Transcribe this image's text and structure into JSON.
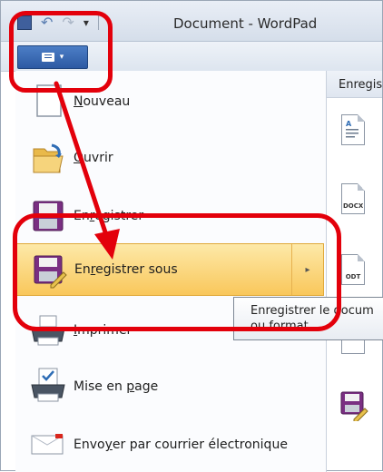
{
  "window": {
    "title": "Document - WordPad"
  },
  "app_button": {
    "icon": "document-icon",
    "caret": "▾"
  },
  "menu": {
    "items": [
      {
        "pre": "",
        "ul": "N",
        "post": "ouveau",
        "icon": "blank-page-icon"
      },
      {
        "pre": "",
        "ul": "O",
        "post": "uvrir",
        "icon": "open-folder-icon"
      },
      {
        "pre": "En",
        "ul": "r",
        "post": "egistrer",
        "icon": "floppy-disk-icon"
      },
      {
        "pre": "En",
        "ul": "r",
        "post": "egistrer sous",
        "icon": "save-as-icon",
        "selected": true,
        "arrow": "▸"
      },
      {
        "pre": "",
        "ul": "I",
        "post": "mprimer",
        "icon": "printer-icon"
      },
      {
        "pre": "Mise en ",
        "ul": "p",
        "post": "age",
        "icon": "page-setup-icon"
      },
      {
        "pre": "Envo",
        "ul": "y",
        "post": "er par courrier électronique",
        "icon": "email-icon"
      }
    ]
  },
  "pane": {
    "header": "Enregis",
    "formats": [
      {
        "tag": "",
        "icon": "rtf-document-icon"
      },
      {
        "tag": "DOCX",
        "icon": "docx-document-icon"
      },
      {
        "tag": "ODT",
        "icon": "odt-document-icon"
      },
      {
        "tag": "",
        "icon": "text-document-icon"
      },
      {
        "tag": "",
        "icon": "other-format-save-icon"
      }
    ]
  },
  "tooltip": {
    "line1": "Enregistrer le docum",
    "line2": "ou format."
  },
  "colors": {
    "annotation": "#e3000b",
    "selection": "#f9c75b",
    "app_button": "#2d5aa3"
  }
}
